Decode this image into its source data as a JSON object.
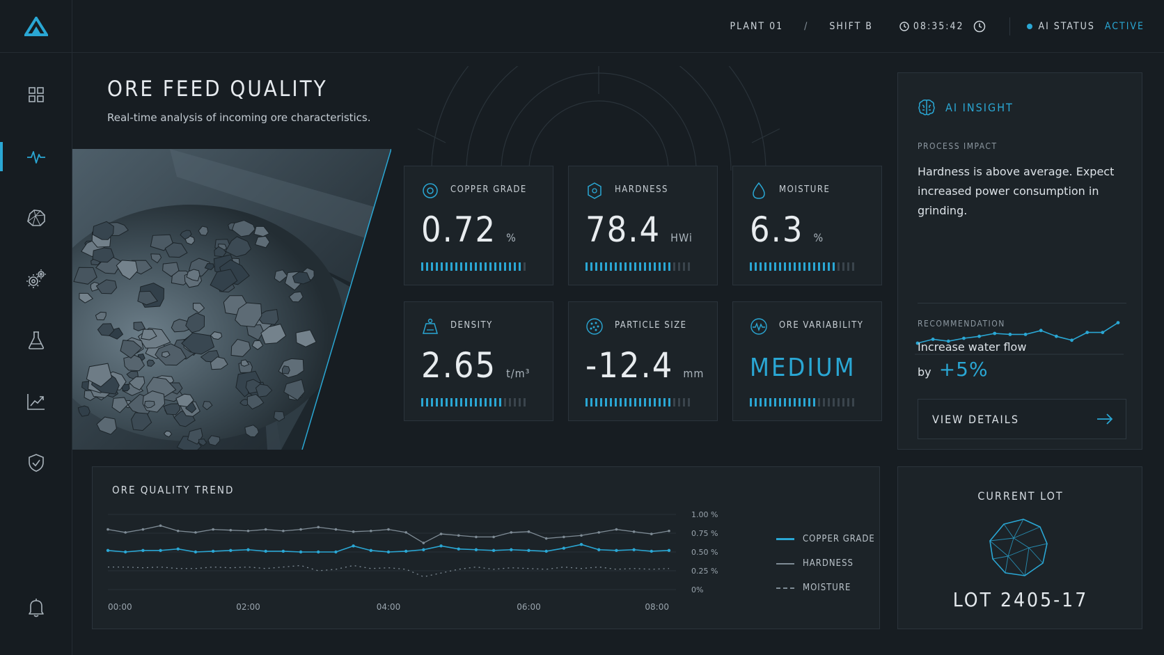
{
  "topbar": {
    "plant": "PLANT 01",
    "separator": "/",
    "shift": "SHIFT B",
    "time": "08:35:42",
    "ai_status_label": "AI STATUS",
    "ai_status_value": "ACTIVE"
  },
  "sidebar": {
    "items": [
      {
        "icon": "dashboard-grid-icon"
      },
      {
        "icon": "activity-pulse-icon",
        "active": true
      },
      {
        "icon": "ore-rock-icon"
      },
      {
        "icon": "gears-icon"
      },
      {
        "icon": "flask-icon"
      },
      {
        "icon": "trend-chart-icon"
      },
      {
        "icon": "shield-check-icon"
      },
      {
        "icon": "bell-icon"
      }
    ]
  },
  "header": {
    "title": "ORE FEED QUALITY",
    "subtitle": "Real-time analysis of incoming ore characteristics."
  },
  "metrics": [
    {
      "label": "COPPER GRADE",
      "value": "0.72",
      "unit": "%",
      "icon": "target-icon",
      "level": 0.95
    },
    {
      "label": "HARDNESS",
      "value": "78.4",
      "unit": "HWi",
      "icon": "shield-hex-icon",
      "level": 0.8
    },
    {
      "label": "MOISTURE",
      "value": "6.3",
      "unit": "%",
      "icon": "droplet-icon",
      "level": 0.8
    },
    {
      "label": "DENSITY",
      "value": "2.65",
      "unit": "t/m³",
      "icon": "weight-icon",
      "level": 0.75
    },
    {
      "label": "PARTICLE SIZE",
      "value": "-12.4",
      "unit": "mm",
      "icon": "particles-icon",
      "level": 0.8
    },
    {
      "label": "ORE VARIABILITY",
      "value": "MEDIUM",
      "unit": "",
      "icon": "variability-pulse-icon",
      "level": 0.65
    }
  ],
  "insight": {
    "title": "AI INSIGHT",
    "impact_label": "PROCESS IMPACT",
    "impact_text": "Hardness is above average. Expect increased power consumption in grinding.",
    "recommendation_label": "RECOMMENDATION",
    "recommendation_text": "Increase water flow",
    "recommendation_by": "by",
    "recommendation_pct": "+5%",
    "view_details": "VIEW DETAILS"
  },
  "trend": {
    "title": "ORE QUALITY TREND"
  },
  "chart_data": {
    "type": "line",
    "title": "ORE QUALITY TREND",
    "x": [
      "00:00",
      "00:15",
      "00:30",
      "00:45",
      "01:00",
      "01:15",
      "01:30",
      "01:45",
      "02:00",
      "02:15",
      "02:30",
      "02:45",
      "03:00",
      "03:15",
      "03:30",
      "03:45",
      "04:00",
      "04:15",
      "04:30",
      "04:45",
      "05:00",
      "05:15",
      "05:30",
      "05:45",
      "06:00",
      "06:15",
      "06:30",
      "06:45",
      "07:00",
      "07:15",
      "07:30",
      "07:45",
      "08:00"
    ],
    "xticks": [
      "00:00",
      "02:00",
      "04:00",
      "06:00",
      "08:00"
    ],
    "yticks": [
      "1.00 %",
      "0.75 %",
      "0.50 %",
      "0.25 %",
      "0%"
    ],
    "ylim": [
      0,
      1.0
    ],
    "legend_position": "right",
    "series": [
      {
        "name": "COPPER GRADE",
        "color": "#2aa7d4",
        "style": "solid",
        "values": [
          0.52,
          0.5,
          0.52,
          0.52,
          0.54,
          0.5,
          0.51,
          0.52,
          0.53,
          0.51,
          0.51,
          0.5,
          0.5,
          0.5,
          0.58,
          0.52,
          0.5,
          0.51,
          0.53,
          0.58,
          0.54,
          0.53,
          0.52,
          0.53,
          0.52,
          0.51,
          0.55,
          0.6,
          0.53,
          0.52,
          0.53,
          0.51,
          0.52
        ]
      },
      {
        "name": "HARDNESS",
        "color": "#7f8c96",
        "style": "solid",
        "values": [
          0.8,
          0.76,
          0.8,
          0.85,
          0.78,
          0.76,
          0.8,
          0.79,
          0.78,
          0.8,
          0.78,
          0.8,
          0.83,
          0.8,
          0.77,
          0.78,
          0.8,
          0.76,
          0.62,
          0.74,
          0.72,
          0.7,
          0.7,
          0.76,
          0.77,
          0.68,
          0.7,
          0.72,
          0.76,
          0.8,
          0.77,
          0.74,
          0.78
        ]
      },
      {
        "name": "MOISTURE",
        "color": "#7f8c96",
        "style": "dashed",
        "values": [
          0.3,
          0.3,
          0.29,
          0.3,
          0.28,
          0.28,
          0.3,
          0.29,
          0.3,
          0.28,
          0.3,
          0.32,
          0.25,
          0.27,
          0.32,
          0.28,
          0.29,
          0.27,
          0.17,
          0.22,
          0.27,
          0.3,
          0.27,
          0.29,
          0.28,
          0.27,
          0.3,
          0.28,
          0.3,
          0.27,
          0.28,
          0.27,
          0.28
        ]
      }
    ]
  },
  "insight_spark": {
    "type": "line",
    "values": [
      0.2,
      0.28,
      0.24,
      0.3,
      0.34,
      0.4,
      0.38,
      0.38,
      0.46,
      0.34,
      0.26,
      0.42,
      0.42,
      0.62
    ]
  },
  "lot": {
    "title": "CURRENT LOT",
    "number": "LOT 2405-17"
  },
  "colors": {
    "accent": "#2aa7d4",
    "panel": "#1c2328",
    "background": "#171d22"
  }
}
